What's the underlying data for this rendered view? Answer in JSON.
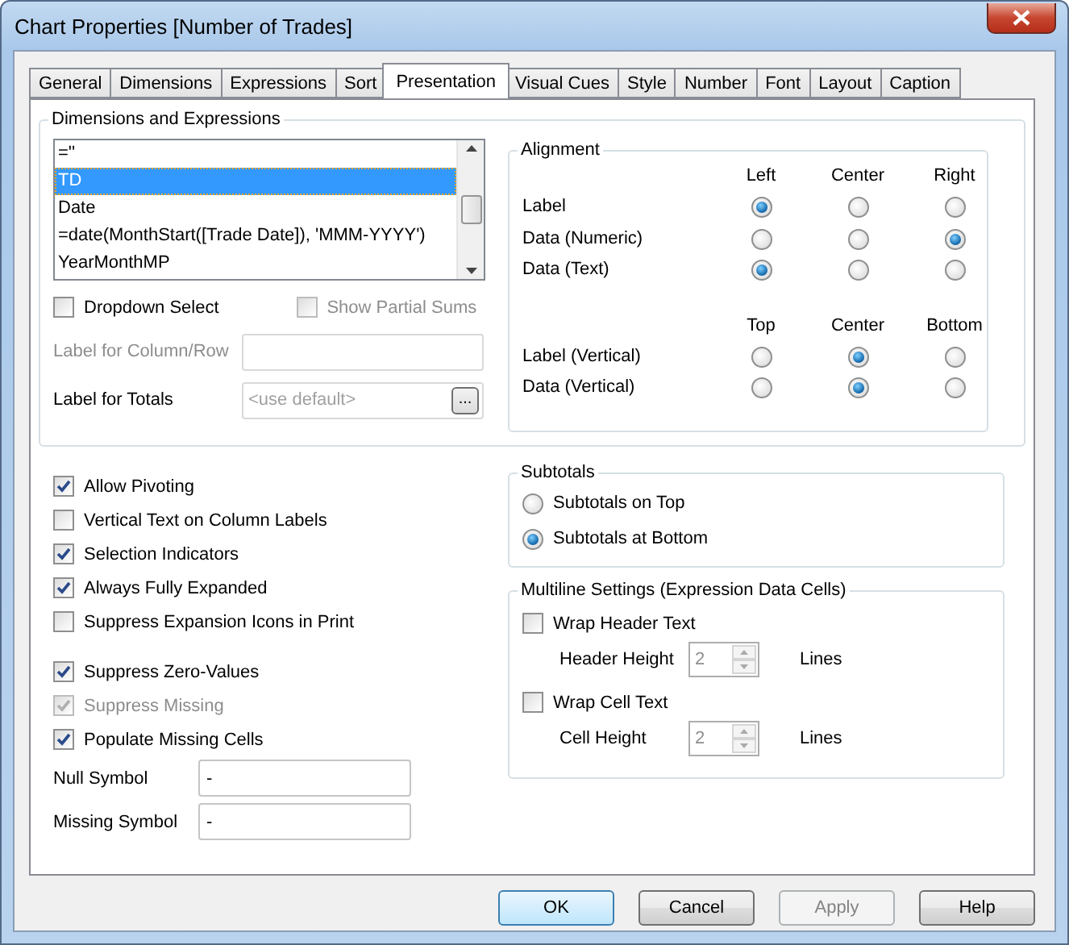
{
  "window": {
    "title": "Chart Properties [Number of Trades]"
  },
  "tabs": [
    {
      "label": "General",
      "selected": false
    },
    {
      "label": "Dimensions",
      "selected": false
    },
    {
      "label": "Expressions",
      "selected": false
    },
    {
      "label": "Sort",
      "selected": false
    },
    {
      "label": "Presentation",
      "selected": true
    },
    {
      "label": "Visual Cues",
      "selected": false
    },
    {
      "label": "Style",
      "selected": false
    },
    {
      "label": "Number",
      "selected": false
    },
    {
      "label": "Font",
      "selected": false
    },
    {
      "label": "Layout",
      "selected": false
    },
    {
      "label": "Caption",
      "selected": false
    }
  ],
  "dimensions_group": {
    "title": "Dimensions and Expressions",
    "list": [
      {
        "label": "=''",
        "selected": false
      },
      {
        "label": "TD",
        "selected": true
      },
      {
        "label": "Date",
        "selected": false
      },
      {
        "label": "=date(MonthStart([Trade Date]), 'MMM-YYYY')",
        "selected": false
      },
      {
        "label": "YearMonthMP",
        "selected": false
      }
    ],
    "checks": [
      {
        "label": "Dropdown Select",
        "checked": false,
        "disabled": false
      },
      {
        "label": "Show Partial Sums",
        "checked": false,
        "disabled": true
      }
    ],
    "label_for_column_row": {
      "label": "Label for Column/Row",
      "disabled": true
    },
    "label_for_totals": {
      "label": "Label for Totals",
      "placeholder": "<use default>",
      "button": "..."
    }
  },
  "alignment": {
    "title": "Alignment",
    "horizontal_headers": [
      "Left",
      "Center",
      "Right"
    ],
    "horizontal_rows": [
      {
        "label": "Label",
        "selected": [
          true,
          false,
          false
        ]
      },
      {
        "label": "Data (Numeric)",
        "selected": [
          false,
          false,
          true
        ]
      },
      {
        "label": "Data (Text)",
        "selected": [
          true,
          false,
          false
        ]
      }
    ],
    "vertical_headers": [
      "Top",
      "Center",
      "Bottom"
    ],
    "vertical_rows": [
      {
        "label": "Label (Vertical)",
        "selected": [
          false,
          true,
          false
        ]
      },
      {
        "label": "Data (Vertical)",
        "selected": [
          false,
          true,
          false
        ]
      }
    ]
  },
  "options_1": [
    {
      "label": "Allow Pivoting",
      "checked": true,
      "disabled": false
    },
    {
      "label": "Vertical Text on Column Labels",
      "checked": false,
      "disabled": false
    },
    {
      "label": "Selection Indicators",
      "checked": true,
      "disabled": false
    },
    {
      "label": "Always Fully Expanded",
      "checked": true,
      "disabled": false
    },
    {
      "label": "Suppress Expansion Icons in Print",
      "checked": false,
      "disabled": false
    }
  ],
  "options_2": [
    {
      "label": "Suppress Zero-Values",
      "checked": true,
      "disabled": false
    },
    {
      "label": "Suppress Missing",
      "checked": true,
      "disabled": true
    },
    {
      "label": "Populate Missing Cells",
      "checked": true,
      "disabled": false
    }
  ],
  "symbols": [
    {
      "label": "Null Symbol",
      "value": "-"
    },
    {
      "label": "Missing Symbol",
      "value": "-"
    }
  ],
  "subtotals": {
    "title": "Subtotals",
    "options": [
      {
        "label": "Subtotals on Top",
        "selected": false
      },
      {
        "label": "Subtotals at Bottom",
        "selected": true
      }
    ]
  },
  "multiline": {
    "title": "Multiline Settings (Expression Data Cells)",
    "rows": [
      {
        "label": "Wrap Header Text",
        "checked": false,
        "height_label": "Header Height",
        "value": "2",
        "value_disabled": true,
        "unit": "Lines"
      },
      {
        "label": "Wrap Cell Text",
        "checked": false,
        "height_label": "Cell Height",
        "value": "2",
        "value_disabled": true,
        "unit": "Lines"
      }
    ]
  },
  "buttons": [
    {
      "label": "OK",
      "default": true,
      "disabled": false
    },
    {
      "label": "Cancel",
      "default": false,
      "disabled": false
    },
    {
      "label": "Apply",
      "default": false,
      "disabled": true
    },
    {
      "label": "Help",
      "default": false,
      "disabled": false
    }
  ]
}
